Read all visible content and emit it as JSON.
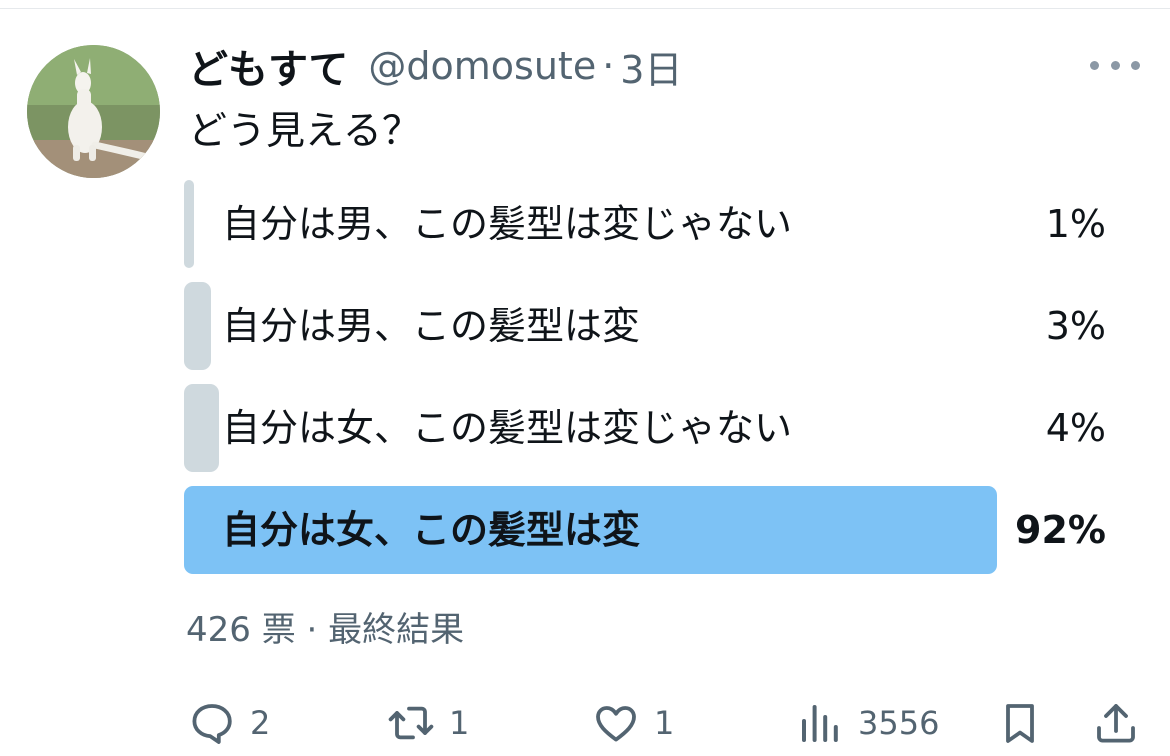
{
  "tweet": {
    "author": {
      "display_name": "どもすて",
      "handle": "@domosute",
      "separator": "·",
      "time": "3日"
    },
    "text": "どう見える？",
    "poll": {
      "options": [
        {
          "label": "自分は男、この髪型は変じゃない",
          "percent_text": "1%",
          "percent": 1
        },
        {
          "label": "自分は男、この髪型は変",
          "percent_text": "3%",
          "percent": 3
        },
        {
          "label": "自分は女、この髪型は変じゃない",
          "percent_text": "4%",
          "percent": 4
        },
        {
          "label": "自分は女、この髪型は変",
          "percent_text": "92%",
          "percent": 92
        }
      ],
      "winner_index": 3,
      "meta": "426 票 · 最終結果"
    },
    "actions": {
      "replies": "2",
      "retweets": "1",
      "likes": "1",
      "views": "3556"
    }
  },
  "colors": {
    "text_primary": "#0f1419",
    "text_secondary": "#536471",
    "poll_bar": "#cfd9de",
    "poll_bar_winner": "#7dc2f5"
  },
  "icons": {
    "reply": "speech-bubble-icon",
    "retweet": "retweet-arrows-icon",
    "like": "heart-icon",
    "views": "bar-chart-icon",
    "bookmark": "bookmark-icon",
    "share": "share-upload-icon",
    "more": "more-horizontal-icon"
  }
}
